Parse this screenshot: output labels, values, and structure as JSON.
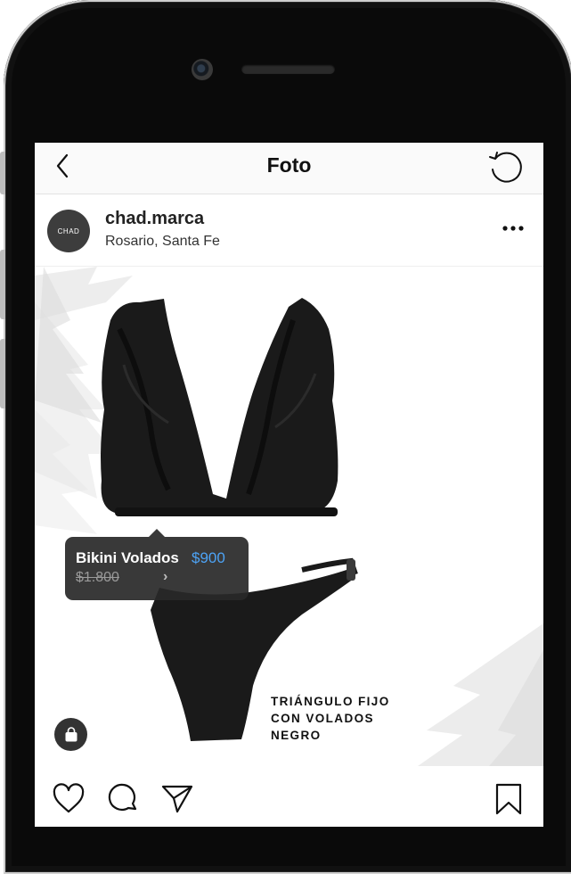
{
  "nav": {
    "title": "Foto",
    "back_icon": "chevron-left-icon",
    "refresh_icon": "refresh-icon"
  },
  "post": {
    "avatar_text": "CHAD",
    "username": "chad.marca",
    "location": "Rosario, Santa Fe",
    "more_icon": "ellipsis-icon"
  },
  "product_tag": {
    "name": "Bikini Volados",
    "price": "$900",
    "old_price": "$1.800",
    "chevron": "›"
  },
  "photo_caption": {
    "lines": [
      "TRIÁNGULO FIJO",
      "CON VOLADOS",
      "NEGRO"
    ]
  },
  "actions": {
    "icons": [
      "heart-icon",
      "comment-icon",
      "send-icon",
      "bookmark-icon",
      "shopping-bag-icon"
    ]
  },
  "colors": {
    "price_accent": "#4da3f5",
    "tag_background": "#282828",
    "frame": "#0a0a0a"
  }
}
